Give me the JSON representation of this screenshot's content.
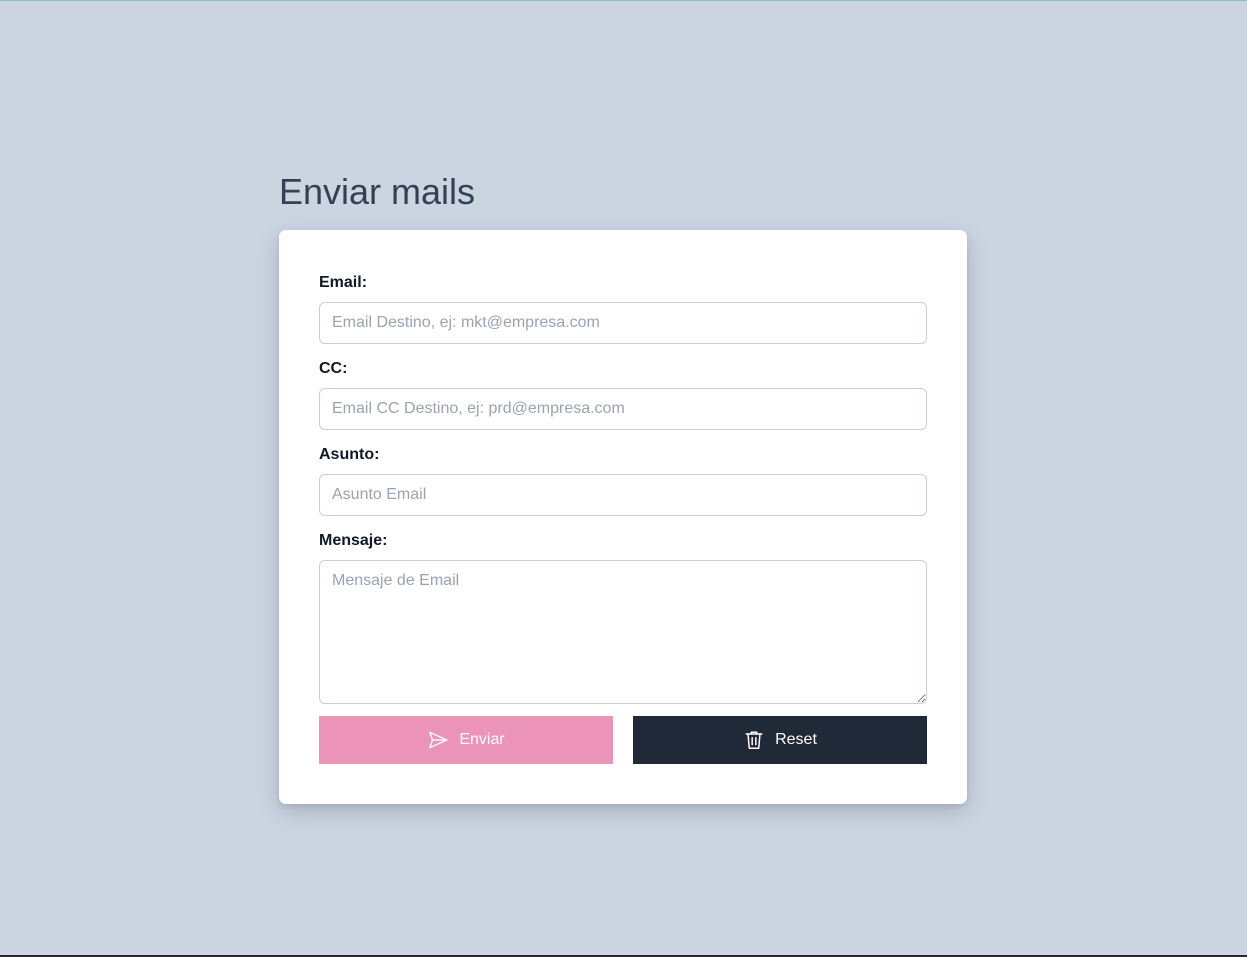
{
  "page": {
    "title": "Enviar mails"
  },
  "form": {
    "email": {
      "label": "Email:",
      "placeholder": "Email Destino, ej: mkt@empresa.com",
      "value": ""
    },
    "cc": {
      "label": "CC:",
      "placeholder": "Email CC Destino, ej: prd@empresa.com",
      "value": ""
    },
    "subject": {
      "label": "Asunto:",
      "placeholder": "Asunto Email",
      "value": ""
    },
    "message": {
      "label": "Mensaje:",
      "placeholder": "Mensaje de Email",
      "value": ""
    }
  },
  "buttons": {
    "send": {
      "label": "Enviar",
      "icon": "send-icon",
      "color": "#ec93b9"
    },
    "reset": {
      "label": "Reset",
      "icon": "trash-icon",
      "color": "#1f2937"
    }
  },
  "colors": {
    "background": "#cbd5e1",
    "card": "#ffffff",
    "title": "#334155"
  }
}
